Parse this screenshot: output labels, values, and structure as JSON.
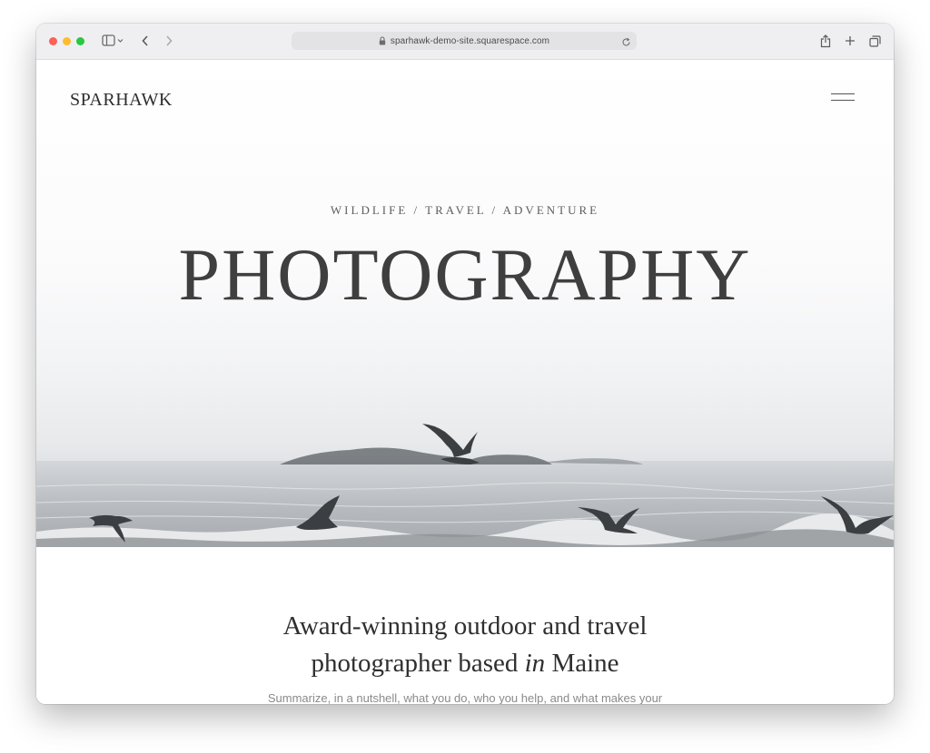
{
  "browser": {
    "url": "sparhawk-demo-site.squarespace.com",
    "icons": {
      "close": "traffic-light-red",
      "minimize": "traffic-light-yellow",
      "zoom": "traffic-light-green",
      "sidebar": "sidebar-icon",
      "back": "chevron-left-icon",
      "forward": "chevron-right-icon",
      "lock": "lock-icon",
      "reload": "reload-icon",
      "share": "share-icon",
      "new_tab": "plus-icon",
      "tabs": "tab-overview-icon"
    }
  },
  "site": {
    "logo": "SPARHAWK",
    "menu_icon": "hamburger-menu-icon",
    "hero": {
      "subtitle": "WILDLIFE / TRAVEL / ADVENTURE",
      "headline": "PHOTOGRAPHY",
      "image": "seagulls flying over foggy ocean with rocks"
    },
    "about": {
      "title_line1": "Award-winning outdoor and travel",
      "title_line2_pre": "photographer based ",
      "title_line2_em": "in",
      "title_line2_post": " Maine",
      "text": "Summarize, in a nutshell, what you do, who you help, and what makes your"
    }
  },
  "colors": {
    "toolbar_bg": "#efeff1",
    "text_dark": "#2f2f2f",
    "text_muted": "#8a8a8a"
  }
}
